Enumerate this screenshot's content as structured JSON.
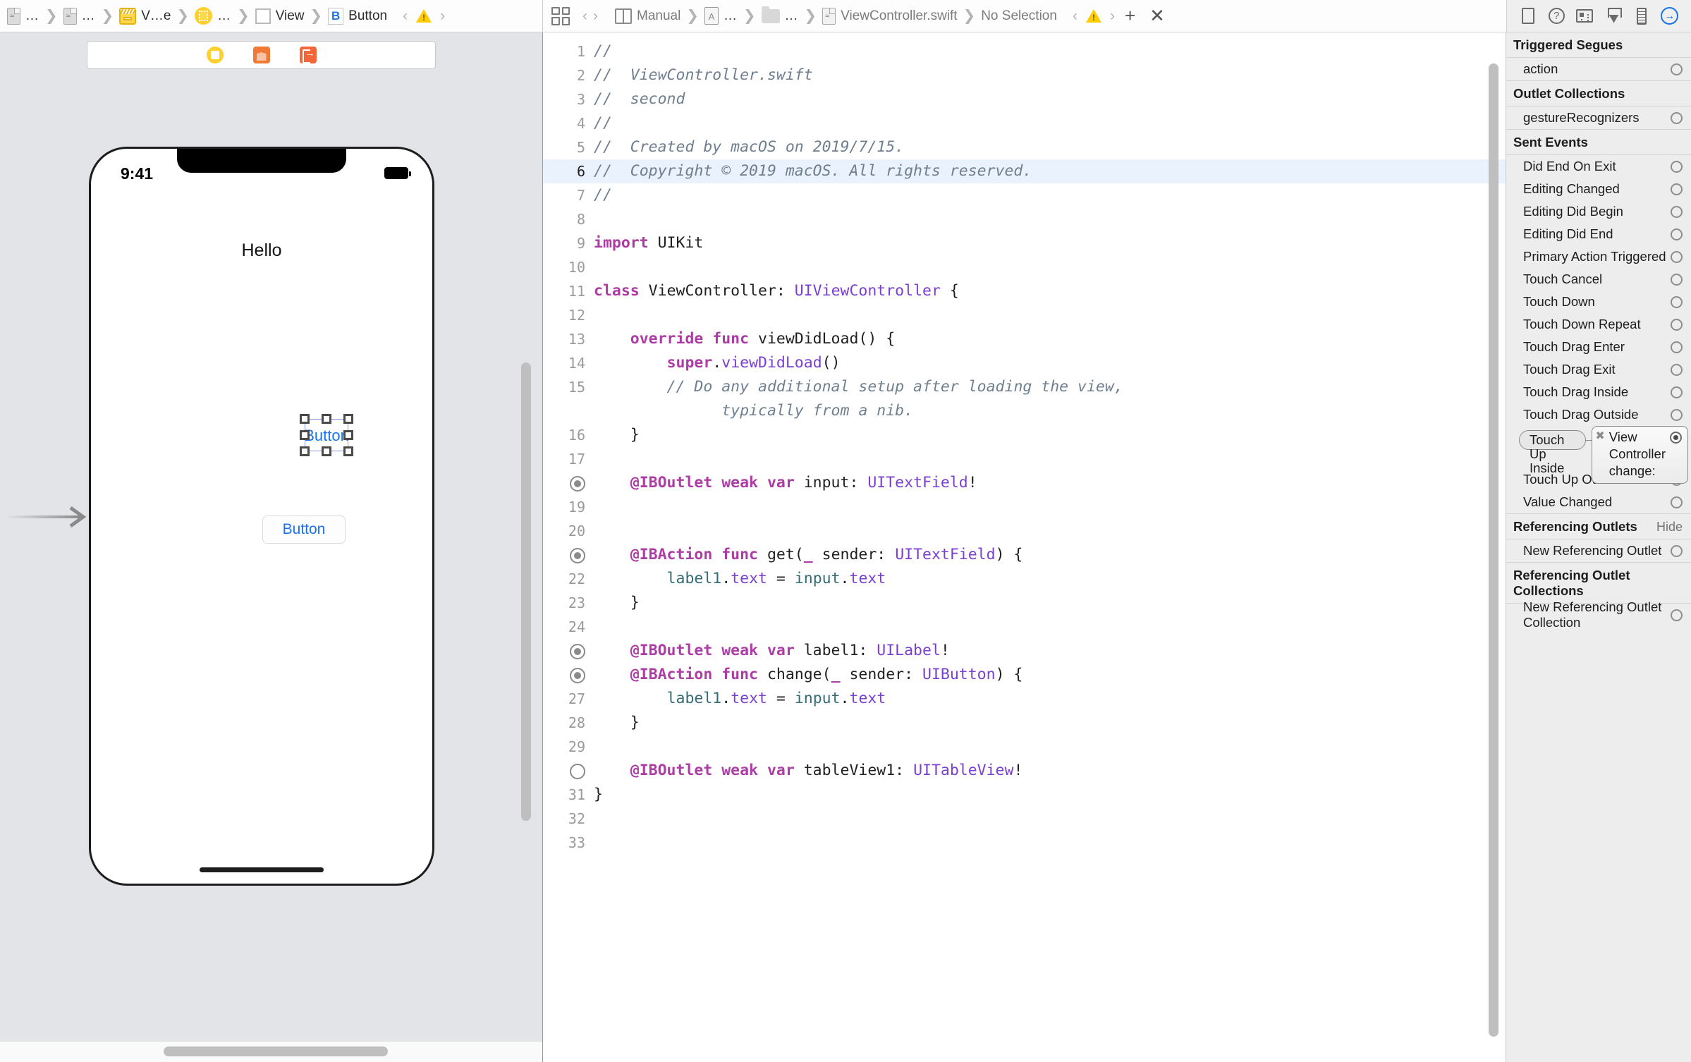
{
  "jumpbar_left": {
    "crumbs": [
      {
        "icon": "swift-file-icon",
        "label": "…"
      },
      {
        "icon": "swift-file-icon",
        "label": "…"
      },
      {
        "icon": "storyboard-icon",
        "label": "V…e"
      },
      {
        "icon": "view-controller-icon",
        "label": "…"
      },
      {
        "icon": "view-icon",
        "label": "View"
      },
      {
        "icon": "button-icon",
        "label": "Button"
      }
    ],
    "back_label": "‹",
    "forward_label": "›",
    "warning_icon": "warning-triangle-icon"
  },
  "jumpbar_mid": {
    "related_items_icon": "related-items-grid-icon",
    "back_label": "‹",
    "forward_label": "›",
    "crumbs": [
      {
        "icon": "assistant-split-icon",
        "label": "Manual"
      },
      {
        "icon": "assets-file-icon",
        "label": "…"
      },
      {
        "icon": "folder-icon",
        "label": "…"
      },
      {
        "icon": "swift-doc-icon",
        "label": "ViewController.swift"
      },
      {
        "icon": "",
        "label": "No Selection"
      }
    ],
    "warning_icon": "warning-triangle-icon",
    "add_label": "+",
    "close_label": "✕"
  },
  "inspector_toolbar": {
    "icons": [
      {
        "name": "file-inspector-icon",
        "active": false
      },
      {
        "name": "quick-help-icon",
        "active": false
      },
      {
        "name": "identity-inspector-icon",
        "active": false
      },
      {
        "name": "attributes-inspector-icon",
        "active": false
      },
      {
        "name": "size-inspector-icon",
        "active": false
      },
      {
        "name": "connections-inspector-icon",
        "active": true
      }
    ]
  },
  "canvas": {
    "ib_toolbar_icons": [
      "view-controller-placeholder-icon",
      "first-responder-icon",
      "exit-icon"
    ],
    "device": {
      "status_time": "9:41",
      "battery_icon": "battery-icon",
      "label_hello": "Hello",
      "selected_button_title": "Button",
      "plain_button_title": "Button"
    },
    "entry_arrow_icon": "storyboard-entry-point-arrow-icon"
  },
  "editor": {
    "lines": [
      {
        "num": "1",
        "gutter_dot": null,
        "highlight": false,
        "tokens": [
          {
            "t": "//",
            "c": "cmt"
          }
        ]
      },
      {
        "num": "2",
        "gutter_dot": null,
        "highlight": false,
        "tokens": [
          {
            "t": "//  ViewController.swift",
            "c": "cmt"
          }
        ]
      },
      {
        "num": "3",
        "gutter_dot": null,
        "highlight": false,
        "tokens": [
          {
            "t": "//  second",
            "c": "cmt"
          }
        ]
      },
      {
        "num": "4",
        "gutter_dot": null,
        "highlight": false,
        "tokens": [
          {
            "t": "//",
            "c": "cmt"
          }
        ]
      },
      {
        "num": "5",
        "gutter_dot": null,
        "highlight": false,
        "tokens": [
          {
            "t": "//  Created by macOS on 2019/7/15.",
            "c": "cmt"
          }
        ]
      },
      {
        "num": "6",
        "gutter_dot": null,
        "highlight": true,
        "tokens": [
          {
            "t": "//  Copyright © 2019 macOS. All rights reserved.",
            "c": "cmt"
          }
        ]
      },
      {
        "num": "7",
        "gutter_dot": null,
        "highlight": false,
        "tokens": [
          {
            "t": "//",
            "c": "cmt"
          }
        ]
      },
      {
        "num": "8",
        "gutter_dot": null,
        "highlight": false,
        "tokens": []
      },
      {
        "num": "9",
        "gutter_dot": null,
        "highlight": false,
        "tokens": [
          {
            "t": "import",
            "c": "kw"
          },
          {
            "t": " UIKit",
            "c": "plain"
          }
        ]
      },
      {
        "num": "10",
        "gutter_dot": null,
        "highlight": false,
        "tokens": []
      },
      {
        "num": "11",
        "gutter_dot": null,
        "highlight": false,
        "tokens": [
          {
            "t": "class",
            "c": "kw"
          },
          {
            "t": " ViewController: ",
            "c": "plain"
          },
          {
            "t": "UIViewController",
            "c": "typ"
          },
          {
            "t": " {",
            "c": "plain"
          }
        ]
      },
      {
        "num": "12",
        "gutter_dot": null,
        "highlight": false,
        "tokens": []
      },
      {
        "num": "13",
        "gutter_dot": null,
        "highlight": false,
        "tokens": [
          {
            "t": "    ",
            "c": "plain"
          },
          {
            "t": "override func",
            "c": "kw"
          },
          {
            "t": " viewDidLoad() {",
            "c": "plain"
          }
        ]
      },
      {
        "num": "14",
        "gutter_dot": null,
        "highlight": false,
        "tokens": [
          {
            "t": "        ",
            "c": "plain"
          },
          {
            "t": "super",
            "c": "kw"
          },
          {
            "t": ".",
            "c": "plain"
          },
          {
            "t": "viewDidLoad",
            "c": "mem"
          },
          {
            "t": "()",
            "c": "plain"
          }
        ]
      },
      {
        "num": "15",
        "gutter_dot": null,
        "highlight": false,
        "wrap": true,
        "tokens": [
          {
            "t": "        ",
            "c": "plain"
          },
          {
            "t": "// Do any additional setup after loading the view,\n              typically from a nib.",
            "c": "cmt"
          }
        ]
      },
      {
        "num": "16",
        "gutter_dot": null,
        "highlight": false,
        "tokens": [
          {
            "t": "    }",
            "c": "plain"
          }
        ]
      },
      {
        "num": "17",
        "gutter_dot": null,
        "highlight": false,
        "tokens": []
      },
      {
        "num": "",
        "gutter_dot": "filled",
        "highlight": false,
        "tokens": [
          {
            "t": "    ",
            "c": "plain"
          },
          {
            "t": "@IBOutlet weak var",
            "c": "kw"
          },
          {
            "t": " input: ",
            "c": "plain"
          },
          {
            "t": "UITextField",
            "c": "typ"
          },
          {
            "t": "!",
            "c": "plain"
          }
        ]
      },
      {
        "num": "19",
        "gutter_dot": null,
        "highlight": false,
        "tokens": []
      },
      {
        "num": "20",
        "gutter_dot": null,
        "highlight": false,
        "tokens": []
      },
      {
        "num": "",
        "gutter_dot": "filled",
        "highlight": false,
        "tokens": [
          {
            "t": "    ",
            "c": "plain"
          },
          {
            "t": "@IBAction func",
            "c": "kw"
          },
          {
            "t": " get(",
            "c": "plain"
          },
          {
            "t": "_",
            "c": "kw"
          },
          {
            "t": " sender: ",
            "c": "plain"
          },
          {
            "t": "UITextField",
            "c": "typ"
          },
          {
            "t": ") {",
            "c": "plain"
          }
        ]
      },
      {
        "num": "22",
        "gutter_dot": null,
        "highlight": false,
        "tokens": [
          {
            "t": "        ",
            "c": "plain"
          },
          {
            "t": "label1",
            "c": "prop"
          },
          {
            "t": ".",
            "c": "plain"
          },
          {
            "t": "text",
            "c": "mem"
          },
          {
            "t": " = ",
            "c": "plain"
          },
          {
            "t": "input",
            "c": "prop"
          },
          {
            "t": ".",
            "c": "plain"
          },
          {
            "t": "text",
            "c": "mem"
          }
        ]
      },
      {
        "num": "23",
        "gutter_dot": null,
        "highlight": false,
        "tokens": [
          {
            "t": "    }",
            "c": "plain"
          }
        ]
      },
      {
        "num": "24",
        "gutter_dot": null,
        "highlight": false,
        "tokens": []
      },
      {
        "num": "",
        "gutter_dot": "filled",
        "highlight": false,
        "tokens": [
          {
            "t": "    ",
            "c": "plain"
          },
          {
            "t": "@IBOutlet weak var",
            "c": "kw"
          },
          {
            "t": " label1: ",
            "c": "plain"
          },
          {
            "t": "UILabel",
            "c": "typ"
          },
          {
            "t": "!",
            "c": "plain"
          }
        ]
      },
      {
        "num": "",
        "gutter_dot": "filled",
        "highlight": false,
        "tokens": [
          {
            "t": "    ",
            "c": "plain"
          },
          {
            "t": "@IBAction func",
            "c": "kw"
          },
          {
            "t": " change(",
            "c": "plain"
          },
          {
            "t": "_",
            "c": "kw"
          },
          {
            "t": " sender: ",
            "c": "plain"
          },
          {
            "t": "UIButton",
            "c": "typ"
          },
          {
            "t": ") {",
            "c": "plain"
          }
        ]
      },
      {
        "num": "27",
        "gutter_dot": null,
        "highlight": false,
        "tokens": [
          {
            "t": "        ",
            "c": "plain"
          },
          {
            "t": "label1",
            "c": "prop"
          },
          {
            "t": ".",
            "c": "plain"
          },
          {
            "t": "text",
            "c": "mem"
          },
          {
            "t": " = ",
            "c": "plain"
          },
          {
            "t": "input",
            "c": "prop"
          },
          {
            "t": ".",
            "c": "plain"
          },
          {
            "t": "text",
            "c": "mem"
          }
        ]
      },
      {
        "num": "28",
        "gutter_dot": null,
        "highlight": false,
        "tokens": [
          {
            "t": "    }",
            "c": "plain"
          }
        ]
      },
      {
        "num": "29",
        "gutter_dot": null,
        "highlight": false,
        "tokens": []
      },
      {
        "num": "",
        "gutter_dot": "empty",
        "highlight": false,
        "tokens": [
          {
            "t": "    ",
            "c": "plain"
          },
          {
            "t": "@IBOutlet weak var",
            "c": "kw"
          },
          {
            "t": " tableView1: ",
            "c": "plain"
          },
          {
            "t": "UITableView",
            "c": "typ"
          },
          {
            "t": "!",
            "c": "plain"
          }
        ]
      },
      {
        "num": "31",
        "gutter_dot": null,
        "highlight": false,
        "tokens": [
          {
            "t": "}",
            "c": "plain"
          }
        ]
      },
      {
        "num": "32",
        "gutter_dot": null,
        "highlight": false,
        "tokens": []
      },
      {
        "num": "33",
        "gutter_dot": null,
        "highlight": false,
        "tokens": []
      }
    ]
  },
  "inspector": {
    "sections": [
      {
        "title": "Triggered Segues",
        "hide": null,
        "rows": [
          {
            "label": "action",
            "well": "empty"
          }
        ]
      },
      {
        "title": "Outlet Collections",
        "hide": null,
        "rows": [
          {
            "label": "gestureRecognizers",
            "well": "empty"
          }
        ]
      },
      {
        "title": "Sent Events",
        "hide": null,
        "rows": [
          {
            "label": "Did End On Exit",
            "well": "empty"
          },
          {
            "label": "Editing Changed",
            "well": "empty"
          },
          {
            "label": "Editing Did Begin",
            "well": "empty"
          },
          {
            "label": "Editing Did End",
            "well": "empty"
          },
          {
            "label": "Primary Action Triggered",
            "well": "empty"
          },
          {
            "label": "Touch Cancel",
            "well": "empty"
          },
          {
            "label": "Touch Down",
            "well": "empty"
          },
          {
            "label": "Touch Down Repeat",
            "well": "empty"
          },
          {
            "label": "Touch Drag Enter",
            "well": "empty"
          },
          {
            "label": "Touch Drag Exit",
            "well": "empty"
          },
          {
            "label": "Touch Drag Inside",
            "well": "empty"
          },
          {
            "label": "Touch Drag Outside",
            "well": "empty"
          }
        ],
        "connection": {
          "event_label": "Touch Up Inside",
          "target_title": "View Controller",
          "target_action": "change:",
          "disconnect_label": "✖",
          "well": "filled"
        },
        "rows_after": [
          {
            "label": "Touch Up Outside",
            "well": "empty"
          },
          {
            "label": "Value Changed",
            "well": "empty"
          }
        ]
      },
      {
        "title": "Referencing Outlets",
        "hide": "Hide",
        "rows": [
          {
            "label": "New Referencing Outlet",
            "well": "empty"
          }
        ]
      },
      {
        "title": "Referencing Outlet Collections",
        "hide": null,
        "rows": [
          {
            "label": "New Referencing Outlet Collection",
            "well": "empty"
          }
        ]
      }
    ]
  }
}
